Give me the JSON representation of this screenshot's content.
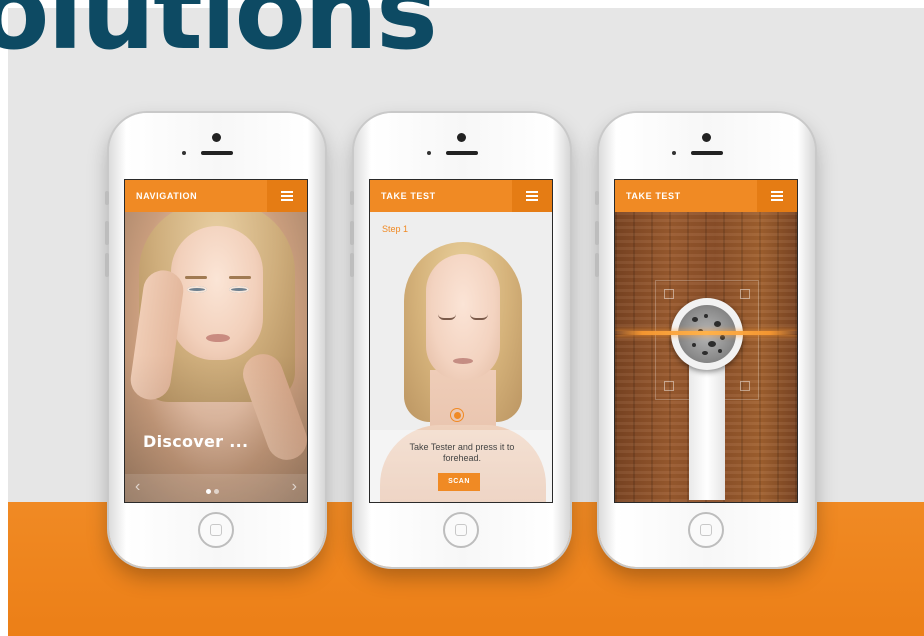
{
  "headline": "olutions",
  "phones": [
    {
      "appbar_title": "NAVIGATION",
      "hero_text": "Discover ...",
      "carousel": {
        "prev_icon": "chevron-left-icon",
        "next_icon": "chevron-right-icon",
        "page_count": 2,
        "current_page": 1
      }
    },
    {
      "appbar_title": "TAKE TEST",
      "step_label": "Step 1",
      "instruction": "Take Tester and press it to forehead.",
      "scan_button": "SCAN"
    },
    {
      "appbar_title": "TAKE TEST"
    }
  ],
  "icons": {
    "menu": "hamburger-menu-icon",
    "target": "target-icon"
  },
  "colors": {
    "accent": "#f08a24",
    "headline": "#0d4a63",
    "backdrop": "#e6e6e6"
  }
}
